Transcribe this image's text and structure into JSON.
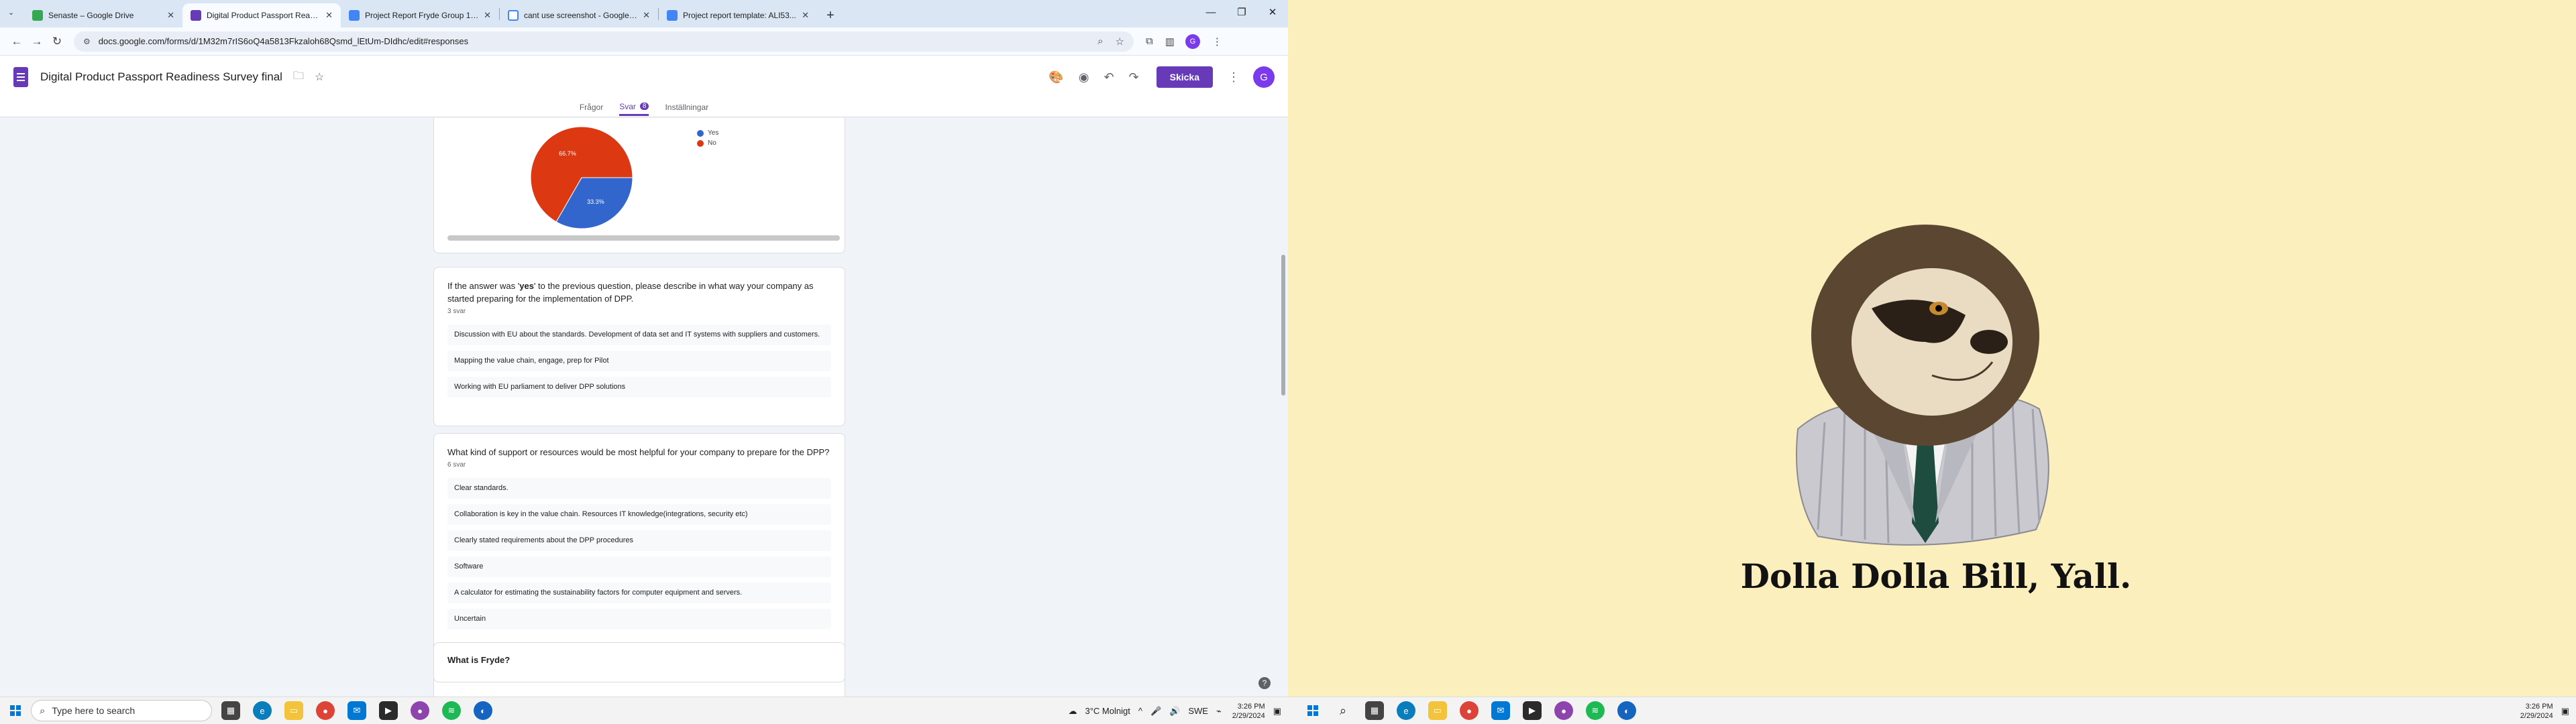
{
  "browser": {
    "tabs": [
      {
        "label": "Senaste – Google Drive",
        "color": "#34a853"
      },
      {
        "label": "Digital Product Passport Readi...",
        "color": "#673ab7",
        "active": true
      },
      {
        "label": "Project Report Fryde Group 14...",
        "color": "#4285f4"
      },
      {
        "label": "cant use screenshot - Google S...",
        "color": "#4285f4"
      },
      {
        "label": "Project report template: ALI53...",
        "color": "#4285f4"
      }
    ],
    "url": "docs.google.com/forms/d/1M32m7rIS6oQ4a5813Fkzaloh68Qsmd_lEtUm-DIdhc/edit#responses",
    "profile_initial": "G"
  },
  "form": {
    "title": "Digital Product Passport Readiness Survey final",
    "send_label": "Skicka",
    "avatar_initial": "G",
    "tabs": {
      "questions": "Frågor",
      "responses": "Svar",
      "responses_count": "8",
      "settings": "Inställningar"
    }
  },
  "chart_data": {
    "type": "pie",
    "labels": [
      "Yes",
      "No"
    ],
    "values": [
      33.3,
      66.7
    ],
    "value_labels": [
      "33.3%",
      "66.7%"
    ],
    "colors": [
      "#3366cc",
      "#dc3912"
    ],
    "legend_position": "right"
  },
  "questions": [
    {
      "title_before": "If the answer was '",
      "title_bold": "yes",
      "title_after": "' to the previous question, please describe in what way your company as started preparing for the implementation of DPP.",
      "count": "3 svar",
      "responses": [
        "Discussion with EU about the standards. Development of data set and IT systems with suppliers and customers.",
        "Mapping the value chain, engage, prep for Pilot",
        "Working with EU parliament to deliver DPP solutions"
      ]
    },
    {
      "title": "What kind of support or resources would be most helpful for your company to prepare for the DPP?",
      "count": "6 svar",
      "responses": [
        "Clear standards.",
        "Collaboration is key in the value chain. Resources IT knowledge(integrations, security etc)",
        "Clearly stated requirements about the DPP procedures",
        "Software",
        "A calculator for estimating the sustainability factors for computer equipment and servers.",
        "Uncertain"
      ]
    },
    {
      "title": "What is Fryde?"
    }
  ],
  "taskbar": {
    "search_placeholder": "Type here to search",
    "weather": "3°C  Molnigt",
    "lang": "SWE",
    "time": "3:26 PM",
    "date": "2/29/2024"
  },
  "wallpaper": {
    "caption": "Dolla Dolla Bill, Yall."
  }
}
